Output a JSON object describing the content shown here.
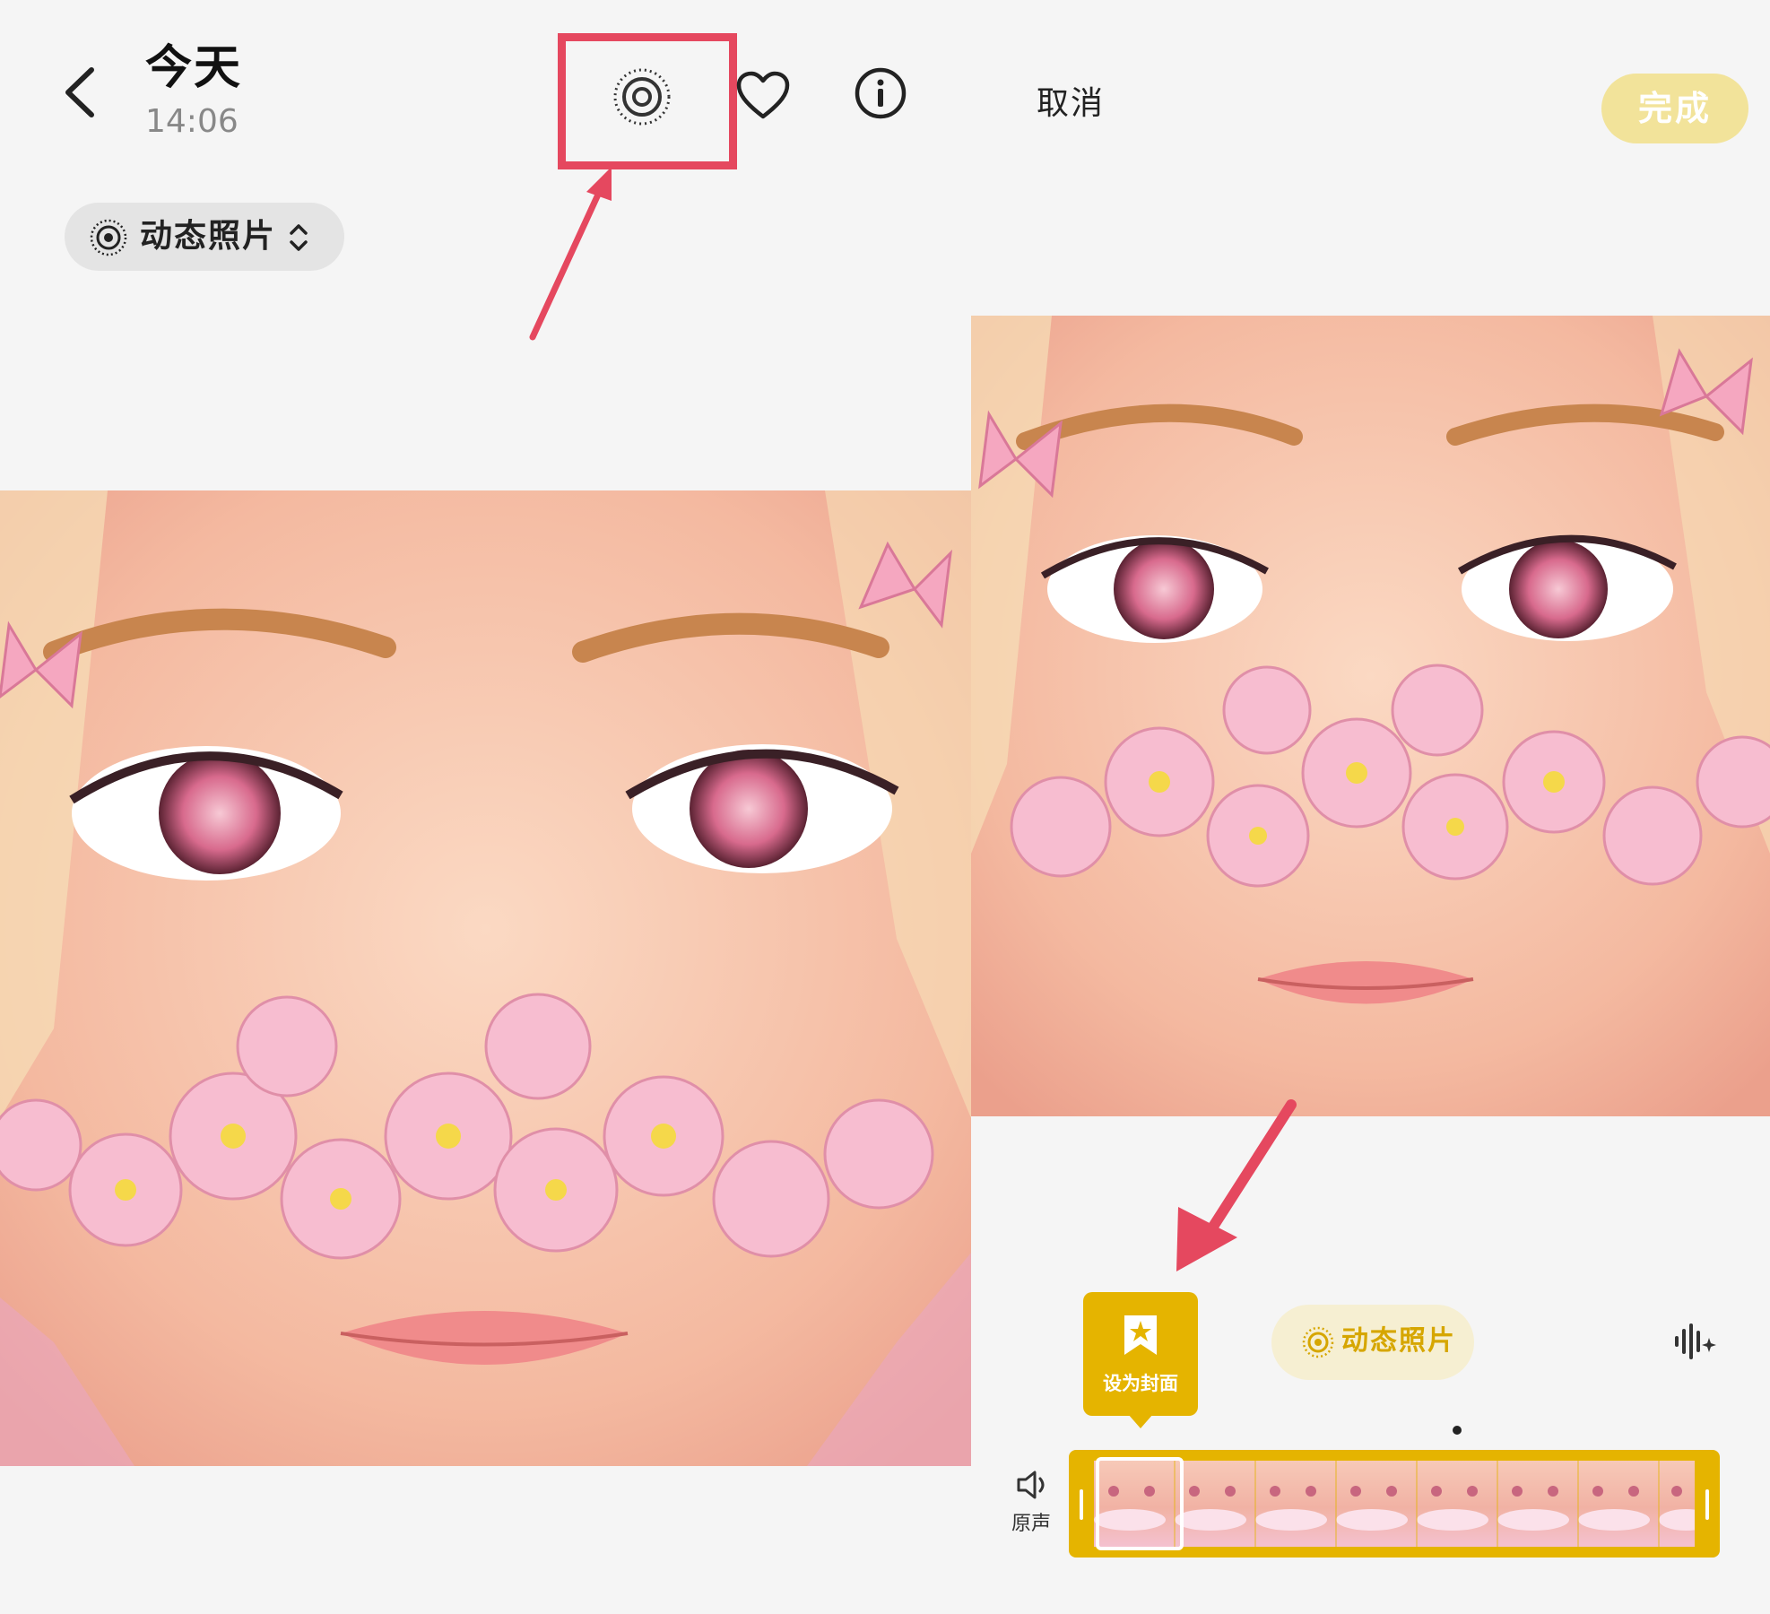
{
  "left_panel": {
    "title": "今天",
    "time": "14:06",
    "icons": {
      "back": "back-chevron-icon",
      "live_photo": "live-photo-icon",
      "favorite": "heart-icon",
      "info": "info-icon"
    },
    "live_pill": {
      "label": "动态照片",
      "icon": "live-photo-icon",
      "chevron": "up-down-chevron-icon"
    },
    "photo": "illustrated face with cherry blossoms and butterflies"
  },
  "right_panel": {
    "cancel_label": "取消",
    "done_label": "完成",
    "cover_tag_label": "设为封面",
    "live_chip_label": "动态照片",
    "sound_label": "原声",
    "icons": {
      "bookmark": "bookmark-star-icon",
      "audio": "audio-wave-icon",
      "speaker": "speaker-icon"
    }
  },
  "colors": {
    "highlight": "#e5485f",
    "accent": "#e5b400",
    "done_bg": "#f2e39a",
    "chip_bg": "#f6efd2"
  }
}
